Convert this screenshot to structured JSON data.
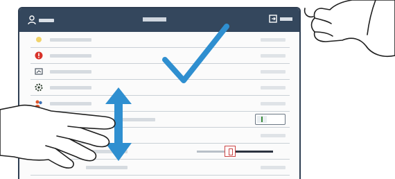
{
  "header": {
    "user_label": "",
    "title": "",
    "exit_label": ""
  },
  "rows": [
    {
      "icon": "flower-icon",
      "label": "",
      "value": ""
    },
    {
      "icon": "alert-icon",
      "label": "",
      "value": ""
    },
    {
      "icon": "gauge-icon",
      "label": "",
      "value": ""
    },
    {
      "icon": "gear-icon",
      "label": "",
      "value": ""
    },
    {
      "icon": "people-icon",
      "label": "",
      "value": ""
    },
    {
      "icon": "toggle-control",
      "label": "",
      "value": ""
    },
    {
      "icon": "",
      "label": "",
      "value": ""
    },
    {
      "icon": "slider-control",
      "label": "",
      "value": ""
    },
    {
      "icon": "",
      "label": "",
      "value": ""
    }
  ],
  "overlay": {
    "checkmark_color": "#2f8fd0",
    "arrow_color": "#2f8fd0"
  },
  "colors": {
    "topbar": "#34475d",
    "frame": "#2e3e52"
  }
}
